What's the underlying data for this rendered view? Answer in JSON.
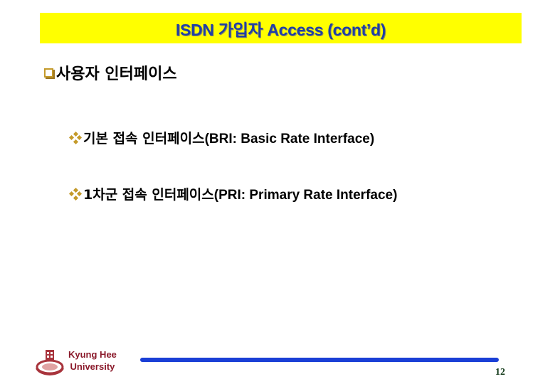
{
  "slide": {
    "title": "ISDN 가입자 Access (cont’d)",
    "bullets": [
      {
        "icon": "square-bullet-icon",
        "text": "사용자 인터페이스",
        "children": [
          {
            "icon": "diamond-bullet-icon",
            "text_ko": "기본 접속 인터페이스",
            "text_en": "(BRI: Basic Rate Interface)"
          },
          {
            "icon": "diamond-bullet-icon",
            "text_ko": "1차군 접속 인터페이스",
            "text_en": "(PRI: Primary Rate Interface)"
          }
        ]
      }
    ]
  },
  "footer": {
    "logo_icon": "university-emblem-icon",
    "university_line1": "Kyung Hee",
    "university_line2": "University",
    "page_number": "12"
  },
  "colors": {
    "title_background": "#ffff00",
    "title_text": "#1f3fa6",
    "bullet": "#c49a2a",
    "university_text": "#8b1a2b",
    "footer_line": "#1a3fd6"
  }
}
